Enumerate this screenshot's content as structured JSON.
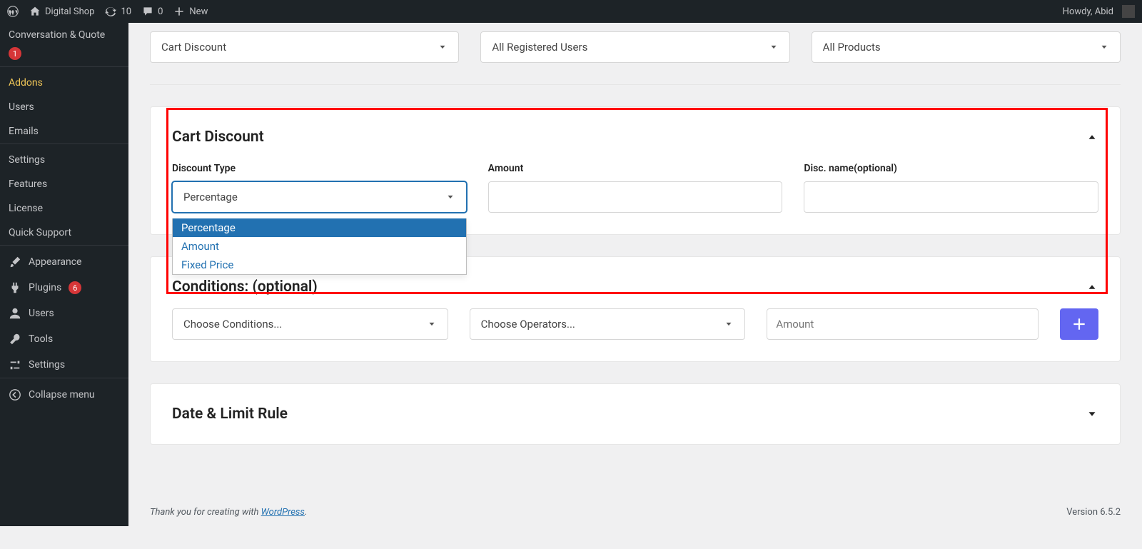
{
  "adminbar": {
    "site_name": "Digital Shop",
    "updates": "10",
    "comments": "0",
    "new_label": "New",
    "howdy_text": "Howdy, Abid"
  },
  "sidebar": {
    "conversation": "Conversation & Quote",
    "conversation_badge": "1",
    "addons": "Addons",
    "users_sub": "Users",
    "emails": "Emails",
    "settings_sub": "Settings",
    "features": "Features",
    "license": "License",
    "quick_support": "Quick Support",
    "appearance": "Appearance",
    "plugins": "Plugins",
    "plugins_badge": "6",
    "users": "Users",
    "tools": "Tools",
    "settings": "Settings",
    "collapse": "Collapse menu"
  },
  "top_selects": {
    "discount_type": "Cart Discount",
    "users": "All Registered Users",
    "products": "All Products"
  },
  "cart_discount": {
    "title": "Cart Discount",
    "type_label": "Discount Type",
    "type_selected": "Percentage",
    "type_options": [
      "Percentage",
      "Amount",
      "Fixed Price"
    ],
    "amount_label": "Amount",
    "discname_label": "Disc. name(optional)"
  },
  "conditions": {
    "title": "Conditions: (optional)",
    "choose_cond": "Choose Conditions...",
    "choose_op": "Choose Operators...",
    "amount_ph": "Amount"
  },
  "date_limit": {
    "title": "Date & Limit Rule"
  },
  "footer": {
    "thanks_pre": "Thank you for creating with ",
    "wordpress": "WordPress",
    "thanks_post": ".",
    "version": "Version 6.5.2"
  }
}
